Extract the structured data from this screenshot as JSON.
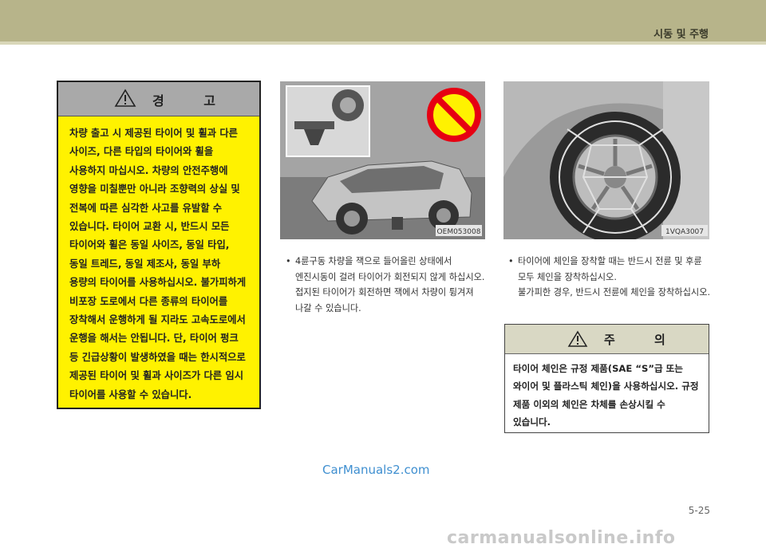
{
  "header": {
    "title": "시동 및 주행"
  },
  "warning": {
    "label": "경 고",
    "text": "차량 출고 시 제공된 타이어 및 휠과 다른 사이즈, 다른 타입의 타이어와 휠을 사용하지 마십시오. 차량의 안전주행에 영향을 미칠뿐만 아니라 조향력의 상실 및 전복에 따른 심각한 사고를 유발할 수 있습니다. 타이어 교환 시, 반드시 모든 타이어와 휠은 동일 사이즈, 동일 타입, 동일 트레드, 동일 제조사, 동일 부하 용량의 타이어를 사용하십시오. 불가피하게 비포장 도로에서 다른 종류의 타이어를 장착해서 운행하게 될 지라도 고속도로에서 운행을 해서는 안됩니다. 단, 타이어 펑크 등 긴급상황이 발생하였을 때는 한시적으로 제공된 타이어 및 휠과 사이즈가 다른 임시 타이어를 사용할 수 있습니다."
  },
  "image1": {
    "code": "OEM053008"
  },
  "image2": {
    "code": "1VQA3007"
  },
  "caption1": {
    "bullet": "•",
    "text": "4륜구동 차량을 잭으로 들어올린 상태에서 엔진시동이 걸려 타이어가 회전되지 않게 하십시오. 접지된 타이어가 회전하면 잭에서 차량이 튕겨져 나갈 수 있습니다."
  },
  "caption2": {
    "bullet": "•",
    "text": "타이어에 체인을 장착할 때는 반드시 전륜 및 후륜 모두 체인을 장착하십시오.",
    "text2": "불가피한 경우, 반드시 전륜에 체인을 장착하십시오."
  },
  "caution": {
    "label": "주 의",
    "text": "타이어 체인은 규정 제품(SAE “S”급 또는 와이어 및 플라스틱 체인)을 사용하십시오. 규정 제품 이외의 체인은 차체를 손상시킬 수 있습니다."
  },
  "watermark1": "CarManuals2.com",
  "page_number": "5-25",
  "watermark2": "carmanualsonline.info",
  "colors": {
    "header": "#b7b48a",
    "warning_bg": "#fff200",
    "caution_head": "#d9d8c4"
  }
}
